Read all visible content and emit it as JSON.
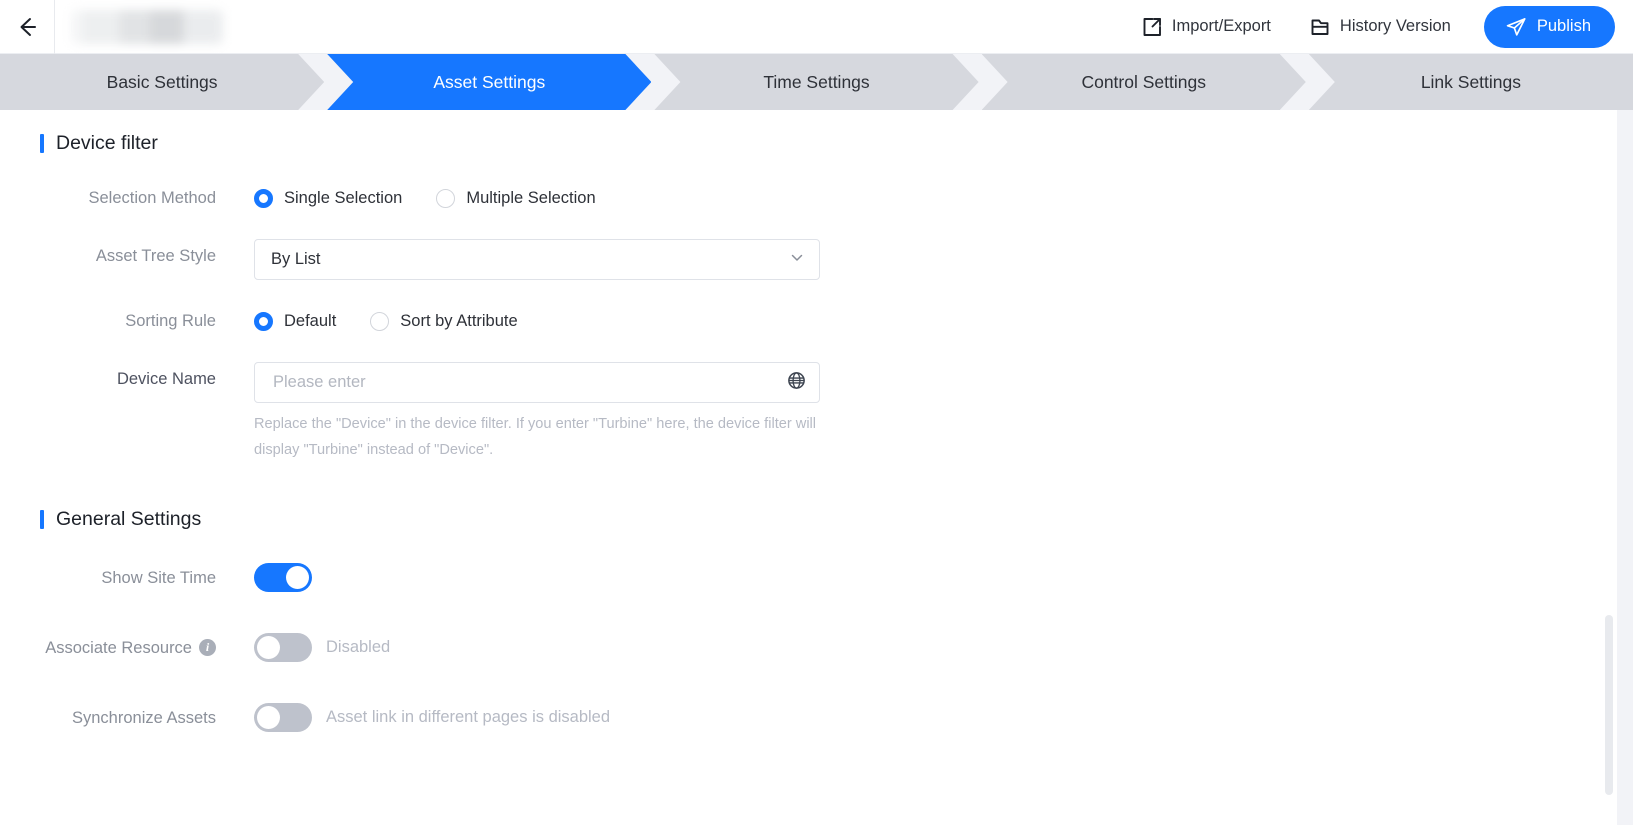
{
  "topbar": {
    "back_icon": "arrow-left-icon",
    "document_title": "",
    "actions": [
      {
        "icon": "import-export-icon",
        "label": "Import/Export"
      },
      {
        "icon": "folder-icon",
        "label": "History Version"
      }
    ],
    "publish": {
      "icon": "send-icon",
      "label": "Publish"
    },
    "accent_color": "#1677ff"
  },
  "steps": [
    {
      "label": "Basic Settings",
      "active": false
    },
    {
      "label": "Asset Settings",
      "active": true
    },
    {
      "label": "Time Settings",
      "active": false
    },
    {
      "label": "Control Settings",
      "active": false
    },
    {
      "label": "Link Settings",
      "active": false
    }
  ],
  "device_filter": {
    "title": "Device filter",
    "selection_method": {
      "label": "Selection Method",
      "options": [
        {
          "label": "Single Selection",
          "checked": true
        },
        {
          "label": "Multiple Selection",
          "checked": false
        }
      ]
    },
    "asset_tree_style": {
      "label": "Asset Tree Style",
      "value": "By List",
      "chevron_icon": "chevron-down-icon"
    },
    "sorting_rule": {
      "label": "Sorting Rule",
      "options": [
        {
          "label": "Default",
          "checked": true
        },
        {
          "label": "Sort by Attribute",
          "checked": false
        }
      ]
    },
    "device_name": {
      "label": "Device Name",
      "value": "",
      "placeholder": "Please enter",
      "globe_icon": "globe-icon",
      "helper": "Replace the \"Device\" in the device filter. If you enter \"Turbine\" here, the device filter will display \"Turbine\" instead of \"Device\"."
    }
  },
  "general_settings": {
    "title": "General Settings",
    "rows": [
      {
        "label": "Show Site Time",
        "toggle_on": true,
        "status_text": "",
        "info_icon": false
      },
      {
        "label": "Associate Resource",
        "toggle_on": false,
        "status_text": "Disabled",
        "info_icon": true
      },
      {
        "label": "Synchronize Assets",
        "toggle_on": false,
        "status_text": "Asset link in different pages is disabled",
        "info_icon": false
      }
    ]
  }
}
